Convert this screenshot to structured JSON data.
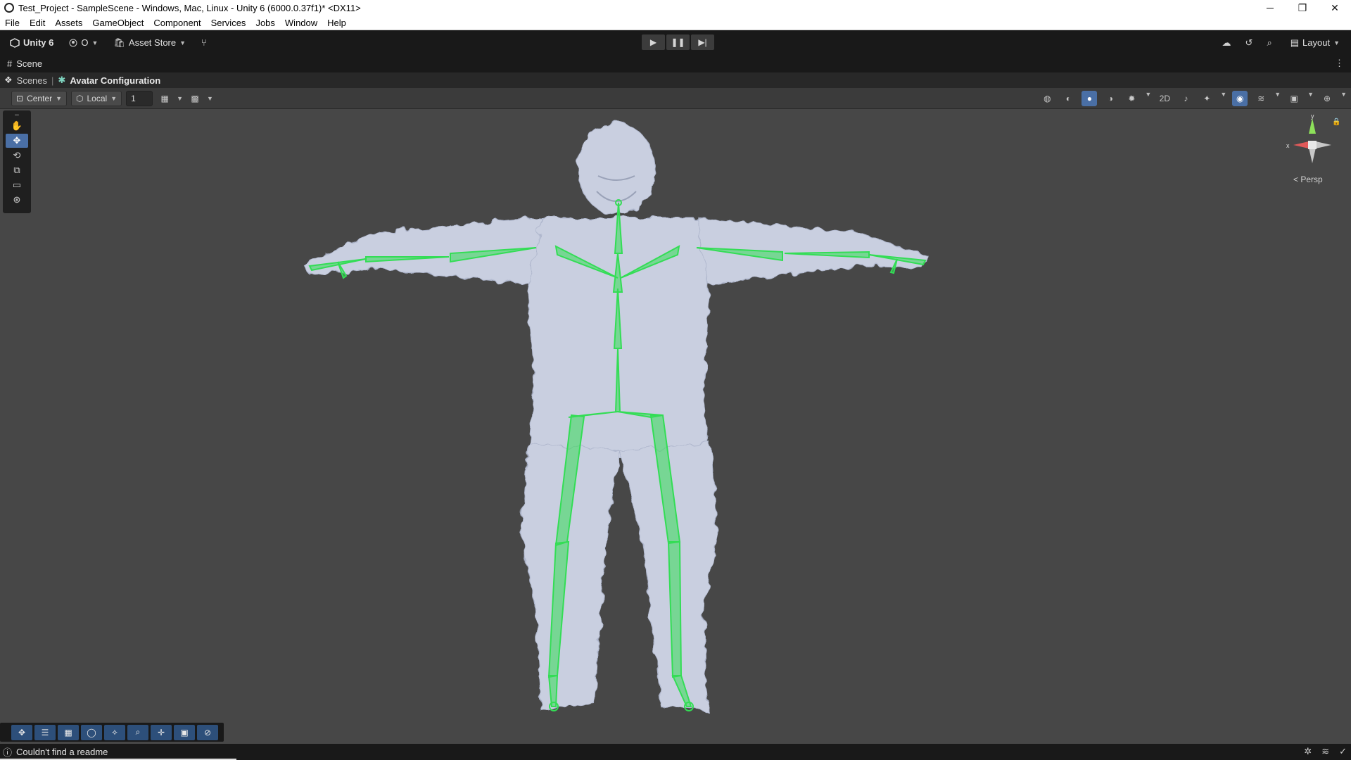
{
  "window": {
    "title": "Test_Project - SampleScene - Windows, Mac, Linux - Unity 6 (6000.0.37f1)* <DX11>",
    "controls": [
      "─",
      "❐",
      "✕"
    ]
  },
  "menu": [
    "File",
    "Edit",
    "Assets",
    "GameObject",
    "Component",
    "Services",
    "Jobs",
    "Window",
    "Help"
  ],
  "toolbar": {
    "unity_label": "Unity 6",
    "account_label": "O",
    "asset_store_label": "Asset Store",
    "layout_label": "Layout"
  },
  "tab": {
    "label": "Scene"
  },
  "breadcrumb": {
    "root": "Scenes",
    "current": "Avatar Configuration"
  },
  "scene_toolbar": {
    "pivot_label": "Center",
    "space_label": "Local",
    "grid_value": "1"
  },
  "gizmo": {
    "x_label": "x",
    "y_label": "y",
    "projection_label": "Persp"
  },
  "status": {
    "message": "Couldn't find a readme"
  },
  "colors": {
    "bone": "#33dd55",
    "mesh": "#c9cfe0",
    "accent": "#4a6fa5"
  }
}
